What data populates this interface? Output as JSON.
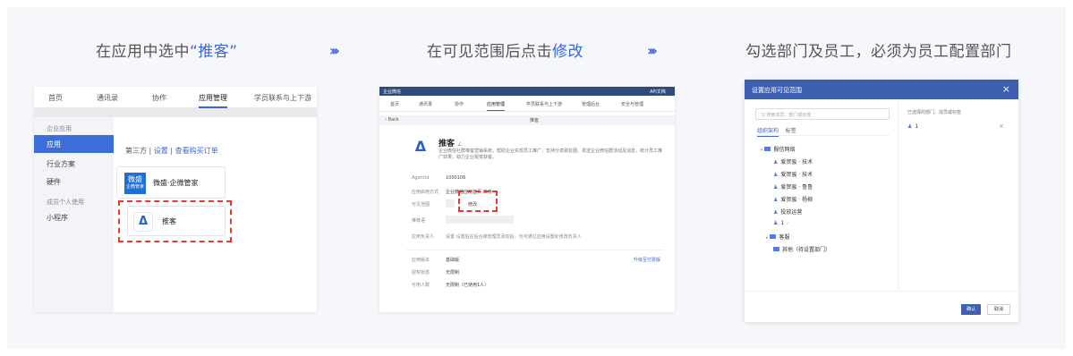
{
  "steps": [
    {
      "prefix": "在应用中选中",
      "highlight": "“推客”"
    },
    {
      "prefix": "在可见范围后点击",
      "highlight": "修改"
    },
    {
      "text": "勾选部门及员工，必须为员工配置部门"
    }
  ],
  "arrow_glyph": "›››",
  "panel1": {
    "nav": [
      "首页",
      "通讯录",
      "协作",
      "应用管理",
      "学员联系与上下游"
    ],
    "sidebar": {
      "group1": "企业应用",
      "items": [
        "应用",
        "行业方案",
        "硬件"
      ],
      "group2": "成员个人使用",
      "item4": "小程序"
    },
    "tabs": {
      "third_party": "第三方",
      "sep1": "|",
      "config": "设置",
      "sep2": "|",
      "orders": "查看购买订单"
    },
    "app1": {
      "logo_line1": "微盛",
      "logo_line2": "企微管家",
      "name": "微盛·企微管家"
    },
    "app2": {
      "logo": "Δ",
      "name": "推客"
    }
  },
  "panel2": {
    "topbar": {
      "left": "企业微信",
      "right": "APi文档"
    },
    "nav": [
      "首页",
      "通讯录",
      "协作",
      "应用管理",
      "学员联系与上下游",
      "管理后台",
      "安全与管理"
    ],
    "back": "‹ Back",
    "page_title": "推客",
    "app": {
      "logo": "Δ",
      "name": "推客",
      "edit": "∠",
      "desc": "企业微信社群推客营销系统，帮助企业实现员工推广，支持分享朋友圈、发送企业微信群活动及消息，统计员工推广效果，助力企业裂变获客。"
    },
    "fields": [
      {
        "label": "AgentId",
        "value": "1000106"
      },
      {
        "label": "应用启用方式",
        "value": "企业微信应用首页 启用"
      },
      {
        "label": "可见范围",
        "value": ""
      },
      {
        "label": "推荐语",
        "value": ""
      },
      {
        "label": "应用负责人",
        "value": "设置  设置后在后台被管理员添加后，也可通过应用设置处修改负责人"
      }
    ],
    "modify_label": "修改",
    "details": [
      {
        "label": "应用版本",
        "value": "基础版"
      },
      {
        "label": "授权状态",
        "value": "无限制"
      },
      {
        "label": "可用人数",
        "value": "无限制（已使用1人）"
      }
    ],
    "right_link": "升级至付费版"
  },
  "panel3": {
    "title": "设置应用可见范围",
    "close": "×",
    "search_placeholder": "Q 搜索成员、部门或标签",
    "tabs": {
      "org": "组织架构",
      "tag": "标签"
    },
    "tree": [
      {
        "label": "殷信网络",
        "level": 0,
        "type": "folder",
        "caret": "▾"
      },
      {
        "label": "爱贺骏 · 技术",
        "level": 1,
        "type": "person"
      },
      {
        "label": "爱贺骏 · 技术",
        "level": 1,
        "type": "person"
      },
      {
        "label": "爱贺骏 · 鲁鲁",
        "level": 1,
        "type": "person"
      },
      {
        "label": "爱贺骏 · 杨柳",
        "level": 1,
        "type": "person"
      },
      {
        "label": "投放运营",
        "level": 1,
        "type": "person"
      },
      {
        "label": "1",
        "level": 1,
        "type": "person",
        "checked": true
      },
      {
        "label": "客服",
        "level": 1,
        "type": "folder",
        "caret": "▸"
      },
      {
        "label": "其他（待设置部门）",
        "level": 1,
        "type": "folder"
      }
    ],
    "selected_label": "已选择的部门、成员或标签",
    "selected": "1",
    "remove": "×",
    "ok": "确认",
    "cancel": "取消"
  }
}
